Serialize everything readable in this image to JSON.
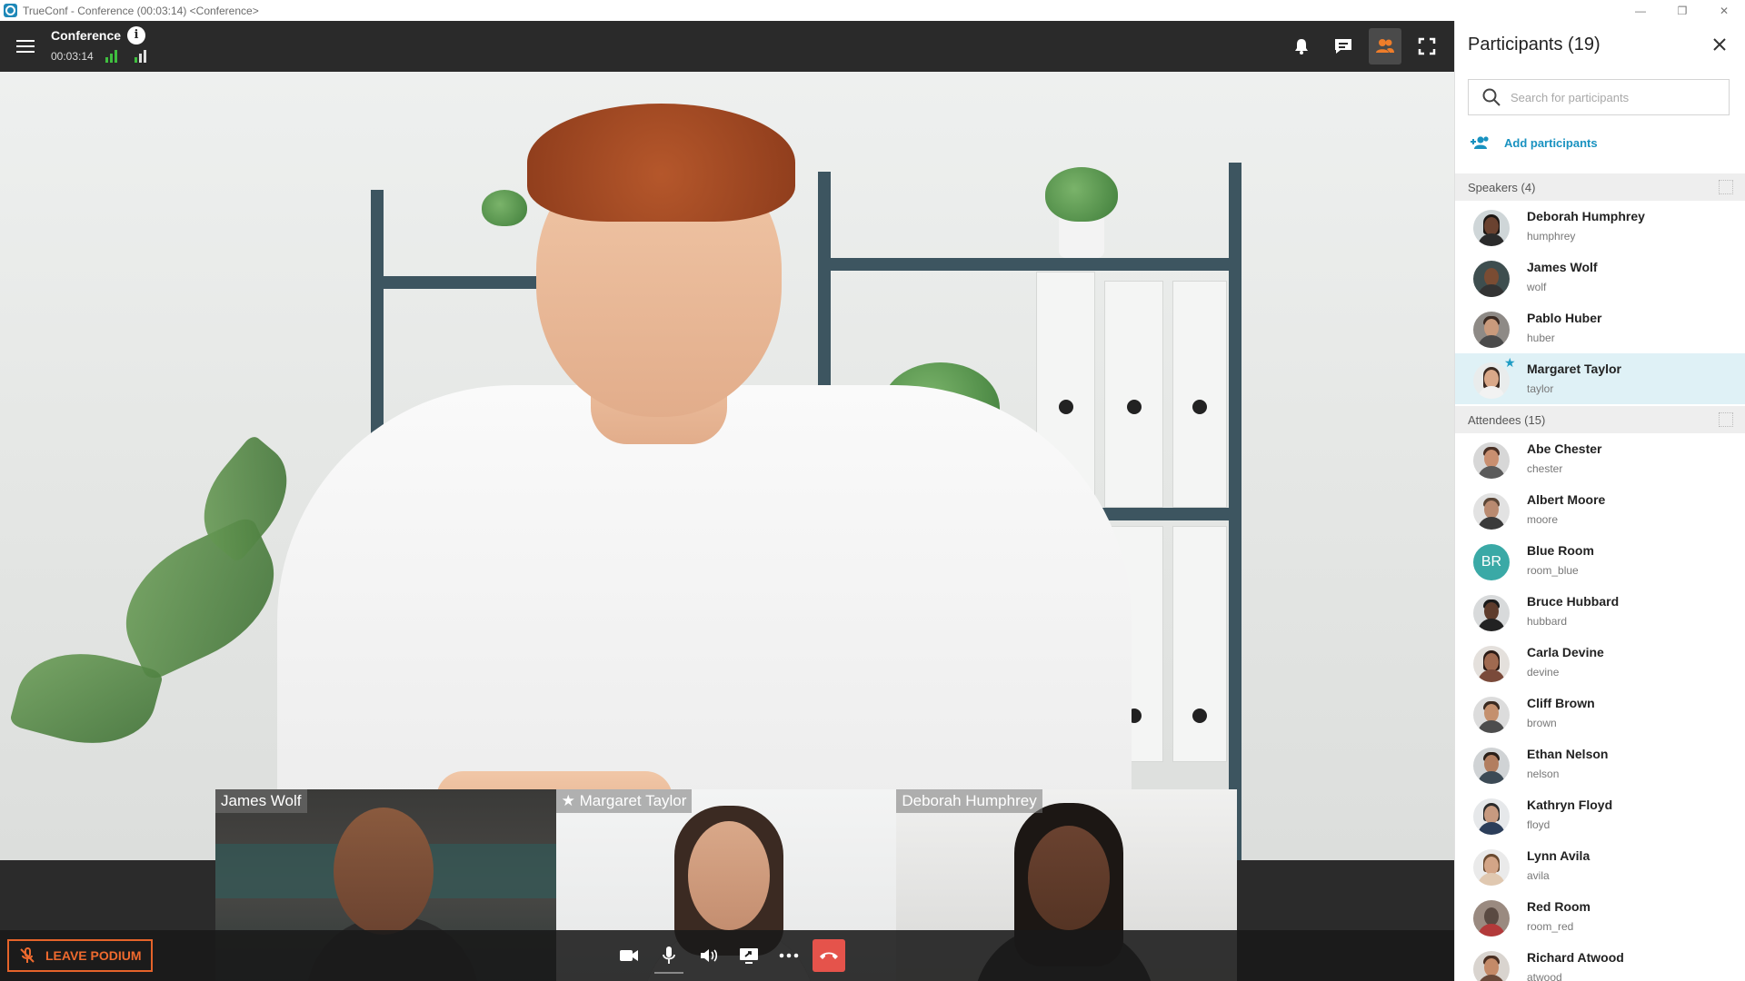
{
  "window": {
    "title": "TrueConf - Conference (00:03:14) <Conference>",
    "minimize": "—",
    "restore": "❐",
    "close": "✕"
  },
  "topbar": {
    "conference_title": "Conference",
    "timer": "00:03:14",
    "info_glyph": "i"
  },
  "icons": {
    "menu": "menu-icon",
    "bell": "bell-icon",
    "chat": "chat-icon",
    "participants": "participants-icon",
    "fullscreen": "fullscreen-icon"
  },
  "colors": {
    "accent": "#1992c0",
    "leave": "#ef6a2e",
    "hangup": "#e5534b",
    "active_toolbar": "#ef7d2a",
    "signal_green": "#3fbf3f",
    "highlight_row": "#dff1f6"
  },
  "thumbnails": [
    {
      "label": "James Wolf"
    },
    {
      "label": "★ Margaret Taylor"
    },
    {
      "label": "Deborah Humphrey"
    }
  ],
  "bottombar": {
    "leave_podium": "LEAVE PODIUM"
  },
  "panel": {
    "title": "Participants (19)",
    "search_placeholder": "Search for participants",
    "add_participants": "Add participants",
    "speakers_header": "Speakers (4)",
    "attendees_header": "Attendees (15)",
    "speakers": [
      {
        "name": "Deborah Humphrey",
        "login": "humphrey"
      },
      {
        "name": "James Wolf",
        "login": "wolf"
      },
      {
        "name": "Pablo Huber",
        "login": "huber"
      },
      {
        "name": "Margaret Taylor",
        "login": "taylor",
        "moderator": true,
        "selected": true
      }
    ],
    "attendees": [
      {
        "name": "Abe Chester",
        "login": "chester"
      },
      {
        "name": "Albert Moore",
        "login": "moore"
      },
      {
        "name": "Blue Room",
        "login": "room_blue",
        "initials": "BR"
      },
      {
        "name": "Bruce Hubbard",
        "login": "hubbard"
      },
      {
        "name": "Carla Devine",
        "login": "devine"
      },
      {
        "name": "Cliff Brown",
        "login": "brown"
      },
      {
        "name": "Ethan Nelson",
        "login": "nelson"
      },
      {
        "name": "Kathryn Floyd",
        "login": "floyd"
      },
      {
        "name": "Lynn Avila",
        "login": "avila"
      },
      {
        "name": "Red Room",
        "login": "room_red"
      },
      {
        "name": "Richard Atwood",
        "login": "atwood"
      }
    ]
  }
}
